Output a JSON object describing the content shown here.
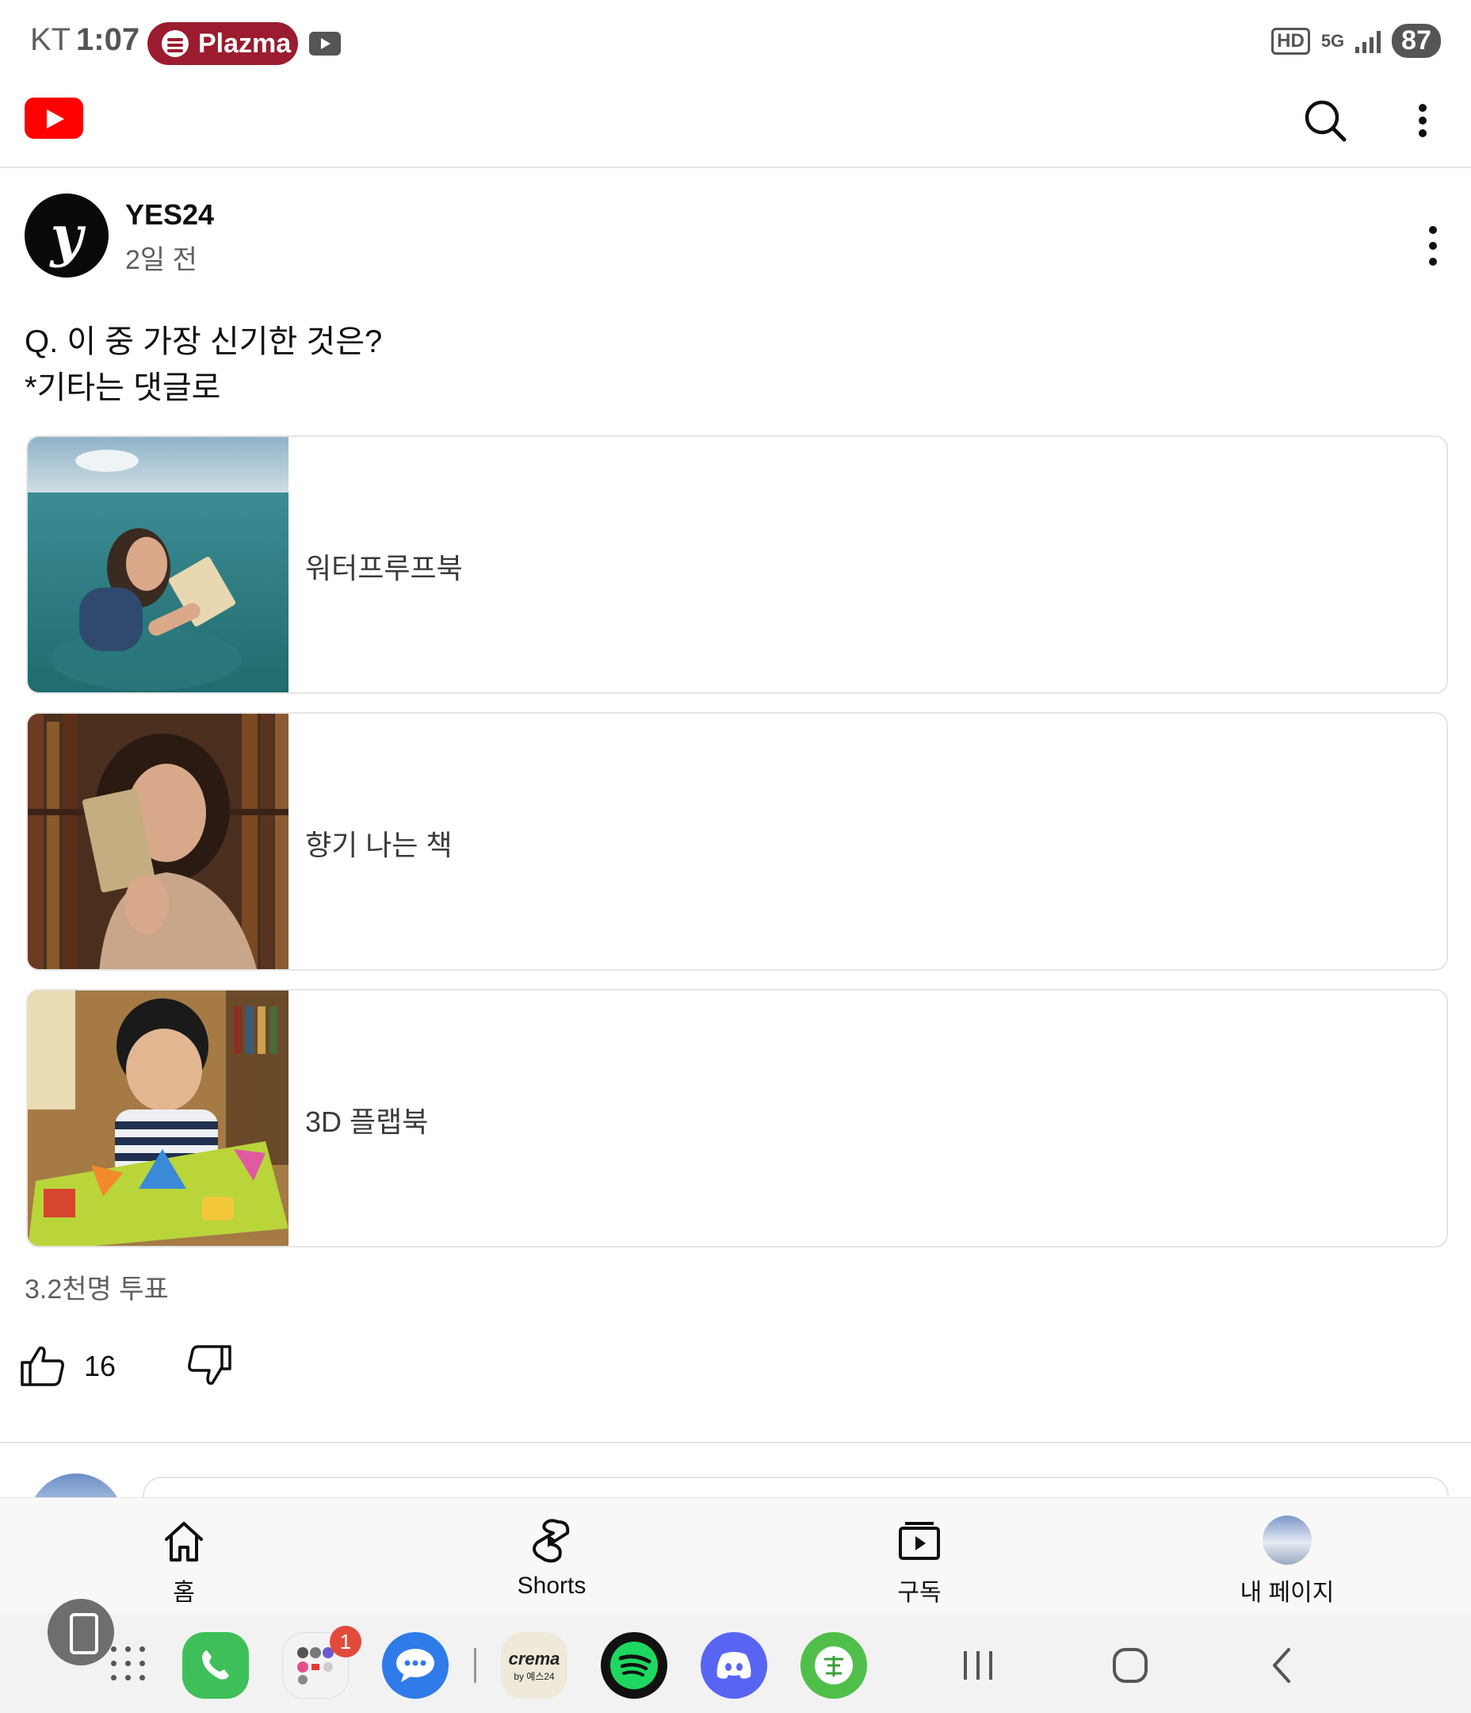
{
  "status_bar": {
    "carrier": "KT",
    "time": "1:07",
    "media_pill": "Plazma",
    "hd": "HD",
    "network": "5G",
    "battery": "87"
  },
  "header": {
    "logo_icon": "youtube-logo",
    "search_icon": "search-icon",
    "more_icon": "more-vert-icon"
  },
  "post": {
    "channel_name": "YES24",
    "avatar_letter": "y",
    "time_ago": "2일 전",
    "question_line1": "Q. 이 중 가장 신기한 것은?",
    "question_line2": "*기타는 댓글로",
    "options": [
      {
        "label": "워터프루프북"
      },
      {
        "label": "향기 나는 책"
      },
      {
        "label": "3D 플랩북"
      }
    ],
    "votes": "3.2천명 투표",
    "likes": "16"
  },
  "bottom_nav": {
    "items": [
      {
        "label": "홈",
        "icon": "home-icon"
      },
      {
        "label": "Shorts",
        "icon": "shorts-icon"
      },
      {
        "label": "구독",
        "icon": "subscriptions-icon"
      },
      {
        "label": "내 페이지",
        "icon": "profile-avatar"
      }
    ]
  },
  "dock": {
    "badge_count": "1",
    "crema_label": "crema",
    "crema_sub": "by 예스24",
    "colors": {
      "phone": "#3fbf5a",
      "messages": "#2f7be9",
      "spotify": "#111111",
      "discord": "#5865f2",
      "hanja": "#4fbf4a"
    }
  },
  "colors": {
    "brand_red": "#ff0000",
    "pill": "#9b1c2e",
    "text_secondary": "#606060",
    "border": "#e5e5e5"
  }
}
